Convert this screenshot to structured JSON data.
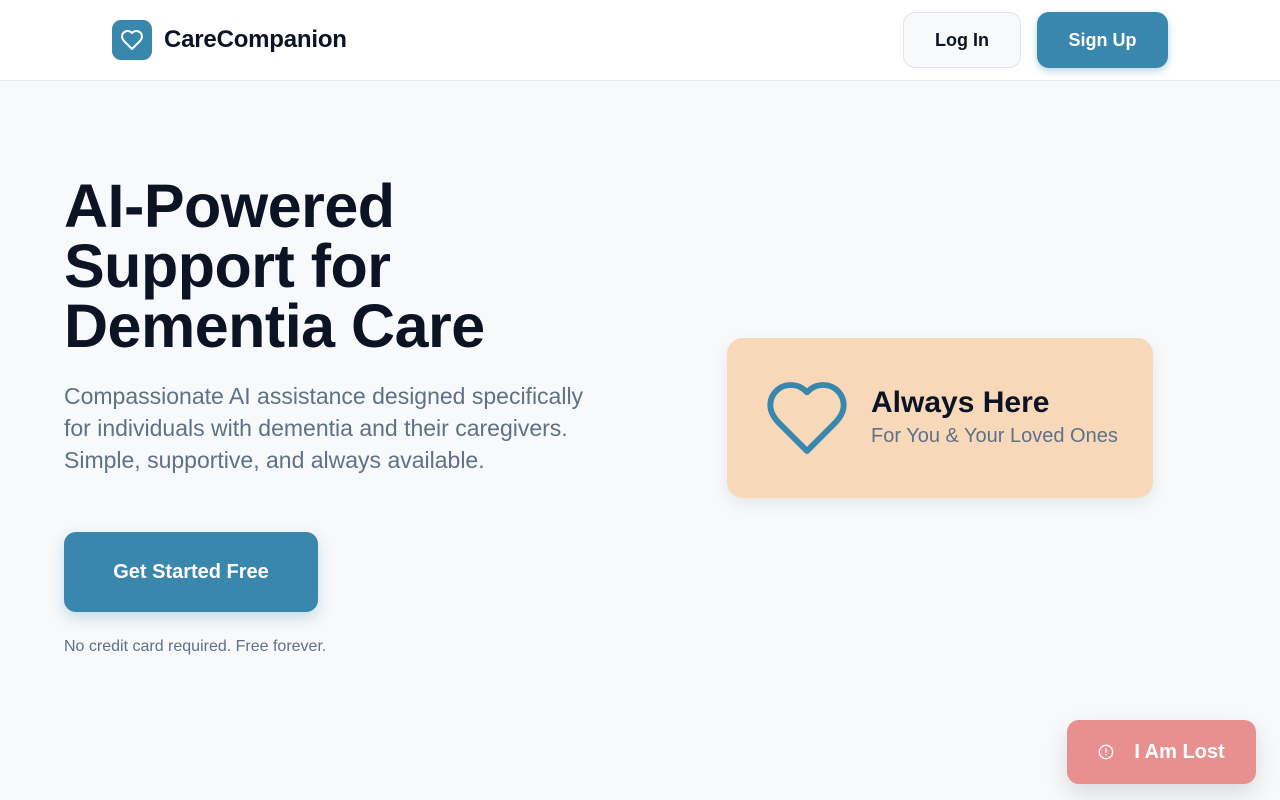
{
  "header": {
    "brand_name": "CareCompanion",
    "logo_icon": "heart-icon",
    "login_label": "Log In",
    "signup_label": "Sign Up"
  },
  "hero": {
    "title": "AI-Powered Support for Dementia Care",
    "subtitle": "Compassionate AI assistance designed specifically for individuals with dementia and their caregivers. Simple, supportive, and always available.",
    "cta_label": "Get Started Free",
    "cta_note": "No credit card required. Free forever."
  },
  "card": {
    "icon": "heart-outline-icon",
    "title": "Always Here",
    "subtitle": "For You & Your Loved Ones"
  },
  "emergency": {
    "icon": "alert-circle-icon",
    "label": "I Am Lost"
  },
  "colors": {
    "primary": "#3a87ad",
    "background": "#f7f9fb",
    "card_bg": "#f7d9b9",
    "emergency": "#e89090",
    "text_dark": "#0b1324",
    "text_muted": "#5e7189"
  }
}
